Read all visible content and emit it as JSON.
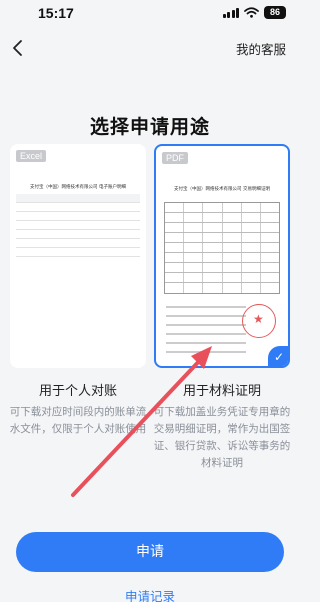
{
  "status_bar": {
    "time": "15:17",
    "battery": "86"
  },
  "nav": {
    "service_label": "我的客服"
  },
  "page_title": "选择申请用途",
  "options": [
    {
      "badge": "Excel",
      "doc_title": "支付宝（中国）网络技术有限公司 电子账户明细",
      "label": "用于个人对账",
      "desc": "可下载对应时间段内的账单流水文件，仅限于个人对账使用"
    },
    {
      "badge": "PDF",
      "doc_title": "支付宝（中国）网络技术有限公司 交易明细证明",
      "label": "用于材料证明",
      "desc": "可下载加盖业务凭证专用章的交易明细证明，常作为出国签证、银行贷款、诉讼等事务的材料证明",
      "selected": true
    }
  ],
  "apply_button": "申请",
  "records_link": "申请记录",
  "colors": {
    "accent": "#2f7cf6",
    "annotation_arrow": "#e8505b"
  }
}
